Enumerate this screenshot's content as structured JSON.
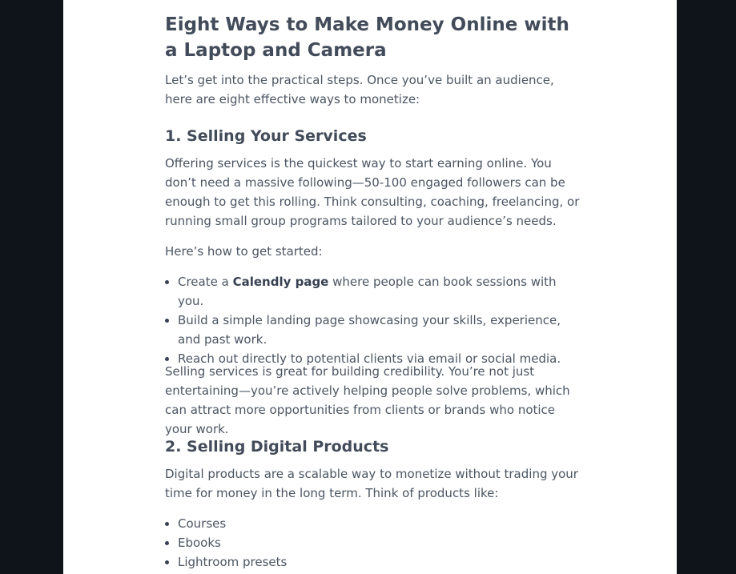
{
  "article": {
    "title": "Eight Ways to Make Money Online with a Laptop and Camera",
    "intro": "Let’s get into the practical steps. Once you’ve built an audience, here are eight effective ways to monetize:",
    "section1": {
      "heading": "1. Selling Your Services",
      "para1": "Offering services is the quickest way to start earning online. You don’t need a massive following—50-100 engaged followers can be enough to get this rolling. Think consulting, coaching, freelancing, or running small group programs tailored to your audience’s needs.",
      "para2": "Here’s how to get started:",
      "list": [
        {
          "before": "Create a ",
          "bold": "Calendly page",
          "after": " where people can book sessions with you."
        },
        {
          "text": "Build a simple landing page showcasing your skills, experience, and past work."
        },
        {
          "text": "Reach out directly to potential clients via email or social media."
        }
      ],
      "para3": "Selling services is great for building credibility. You’re not just entertaining—you’re actively helping people solve problems, which can attract more opportunities from clients or brands who notice your work."
    },
    "section2": {
      "heading": "2. Selling Digital Products",
      "para1": "Digital products are a scalable way to monetize without trading your time for money in the long term. Think of products like:",
      "list": [
        "Courses",
        "Ebooks",
        "Lightroom presets"
      ]
    }
  }
}
